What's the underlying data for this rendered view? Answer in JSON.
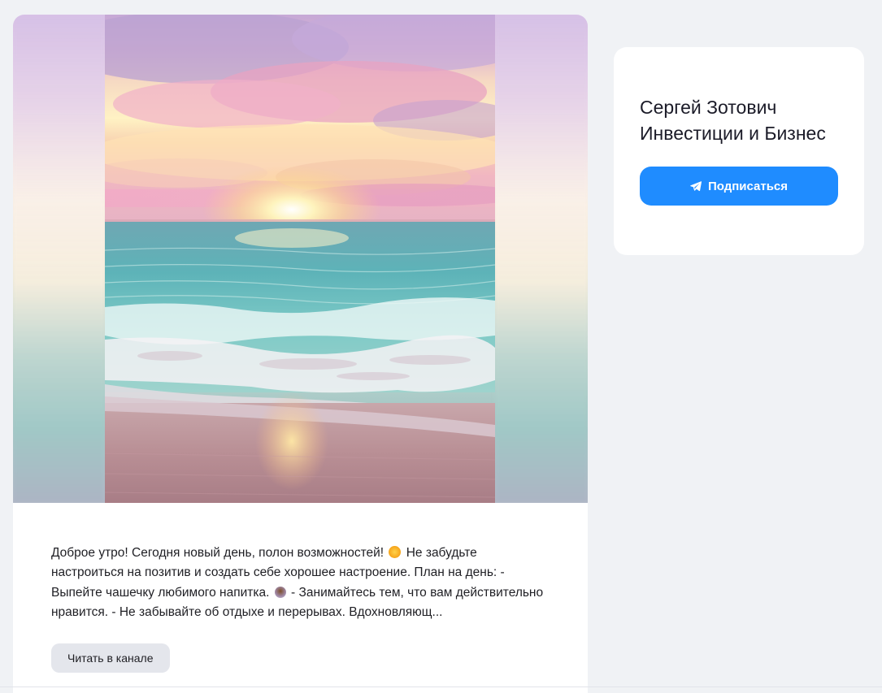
{
  "post": {
    "text_part1": "Доброе утро! Сегодня новый день, полон возможностей!",
    "sun_emoji_icon": "sun-emoji",
    "text_part2": " Не забудьте настроиться на позитив и создать себе хорошее настроение. План на день: - Выпейте чашечку любимого напитка.",
    "tea_emoji_icon": "tea-emoji",
    "text_part3": " - Занимайтесь тем, что вам действительно нравится. - Не забывайте об отдыхе и перерывах. Вдохновляющ...",
    "read_button_label": "Читать в канале"
  },
  "channel": {
    "title": "Сергей Зотович Инвестиции и Бизнес",
    "subscribe_label": "Подписаться",
    "subscribe_icon": "telegram-plane-icon",
    "accent_color": "#1f8cff"
  }
}
